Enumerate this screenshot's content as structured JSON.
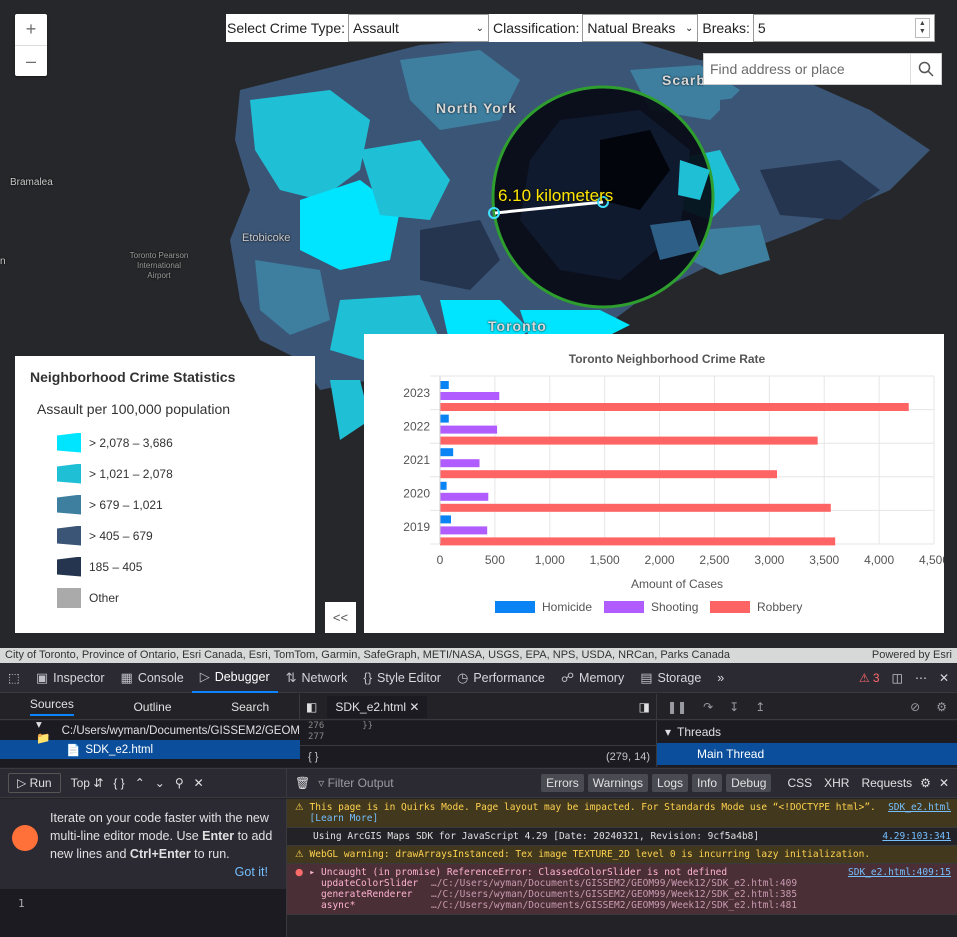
{
  "map": {
    "zoom_in": "+",
    "zoom_out": "–",
    "labels": {
      "north_york": "North York",
      "scarborough": "Scarb",
      "bramalea": "Bramalea",
      "etobicoke": "Etobicoke",
      "toronto": "Toronto",
      "airport": "Toronto Pearson International Airport",
      "edge_n": "n"
    },
    "measure_label": "6.10 kilometers",
    "attribution_left": "City of Toronto, Province of Ontario, Esri Canada, Esri, TomTom, Garmin, SafeGraph, METI/NASA, USGS, EPA, NPS, USDA, NRCan, Parks Canada",
    "attribution_right": "Powered by Esri"
  },
  "toolbar": {
    "crime_type_label": "Select Crime Type:",
    "crime_type_value": "Assault",
    "classification_label": "Classification:",
    "classification_value": "Natual Breaks",
    "breaks_label": "Breaks:",
    "breaks_value": "5"
  },
  "search": {
    "placeholder": "Find address or place",
    "icon": "search-icon"
  },
  "legend": {
    "title": "Neighborhood Crime Statistics",
    "subtitle": "Assault per 100,000 population",
    "items": [
      {
        "label": "> 2,078 – 3,686",
        "color": "#00e5ff"
      },
      {
        "label": "> 1,021 – 2,078",
        "color": "#1fbfd6"
      },
      {
        "label": "> 679 – 1,021",
        "color": "#3e7fa0"
      },
      {
        "label": "> 405 – 679",
        "color": "#3b5576"
      },
      {
        "label": "185 – 405",
        "color": "#25344f"
      },
      {
        "label": "Other",
        "color": "#aaaaaa"
      }
    ]
  },
  "collapse_label": "<<",
  "chart_data": {
    "type": "bar",
    "orientation": "horizontal",
    "title": "Toronto Neighborhood Crime Rate",
    "xlabel": "Amount of Cases",
    "ylabel": "",
    "categories": [
      "2023",
      "2022",
      "2021",
      "2020",
      "2019"
    ],
    "xlim": [
      0,
      4500
    ],
    "xticks": [
      "0",
      "500",
      "1,000",
      "1,500",
      "2,000",
      "2,500",
      "3,000",
      "3,500",
      "4,000",
      "4,500"
    ],
    "series": [
      {
        "name": "Homicide",
        "color": "#0a84f5",
        "values": [
          80,
          80,
          120,
          60,
          100
        ]
      },
      {
        "name": "Shooting",
        "color": "#b05cff",
        "values": [
          540,
          520,
          360,
          440,
          430
        ]
      },
      {
        "name": "Robbery",
        "color": "#ff6464",
        "values": [
          4270,
          3440,
          3070,
          3560,
          3600
        ]
      }
    ],
    "legend_position": "bottom",
    "grid": true
  },
  "devtools": {
    "tabs": [
      {
        "label": "Inspector",
        "icon": "inspector-icon"
      },
      {
        "label": "Console",
        "icon": "console-icon"
      },
      {
        "label": "Debugger",
        "icon": "debugger-icon"
      },
      {
        "label": "Network",
        "icon": "network-icon"
      },
      {
        "label": "Style Editor",
        "icon": "style-editor-icon"
      },
      {
        "label": "Performance",
        "icon": "performance-icon"
      },
      {
        "label": "Memory",
        "icon": "memory-icon"
      },
      {
        "label": "Storage",
        "icon": "storage-icon"
      }
    ],
    "error_count": "3",
    "source_tabs": [
      "Sources",
      "Outline",
      "Search"
    ],
    "file_tab": "SDK_e2.html",
    "tree_path": "C:/Users/wyman/Documents/GISSEM2/GEOM",
    "tree_file": "SDK_e2.html",
    "code_lines": [
      "276",
      "277"
    ],
    "code_snippet": "}}",
    "cursor_braces": "{ }",
    "cursor_pos": "(279, 14)",
    "threads_label": "Threads",
    "main_thread": "Main Thread",
    "run_label": "Run",
    "top_label": "Top",
    "filter_placeholder": "Filter Output",
    "filters": [
      "Errors",
      "Warnings",
      "Logs",
      "Info",
      "Debug"
    ],
    "filters_plain": [
      "CSS",
      "XHR",
      "Requests"
    ],
    "tip_text_1": "Iterate on your code faster with the new multi-line editor mode. Use ",
    "tip_enter": "Enter",
    "tip_text_2": " to add new lines and ",
    "tip_ctrl": "Ctrl+Enter",
    "tip_text_3": " to run.",
    "tip_got_it": "Got it!",
    "line_number": "1",
    "messages": {
      "quirks": "This page is in Quirks Mode. Page layout may be impacted. For Standards Mode use “<!DOCTYPE html>”.",
      "quirks_link": "[Learn More]",
      "quirks_src": "SDK_e2.html",
      "sdk": "Using ArcGIS Maps SDK for JavaScript 4.29 [Date: 20240321, Revision: 9cf5a4b8]",
      "sdk_src": "4.29:103:341",
      "webgl": "WebGL warning: drawArraysInstanced: Tex image TEXTURE_2D level 0 is incurring lazy initialization.",
      "error": "Uncaught (in promise) ReferenceError: ClassedColorSlider is not defined",
      "error_src": "SDK_e2.html:409:15",
      "stack": [
        {
          "fn": "updateColorSlider",
          "loc": "…/C:/Users/wyman/Documents/GISSEM2/GEOM99/Week12/SDK_e2.html:409"
        },
        {
          "fn": "generateRenderer",
          "loc": "…/C:/Users/wyman/Documents/GISSEM2/GEOM99/Week12/SDK_e2.html:385"
        },
        {
          "fn": "async*",
          "loc": "…/C:/Users/wyman/Documents/GISSEM2/GEOM99/Week12/SDK_e2.html:481"
        }
      ]
    }
  }
}
